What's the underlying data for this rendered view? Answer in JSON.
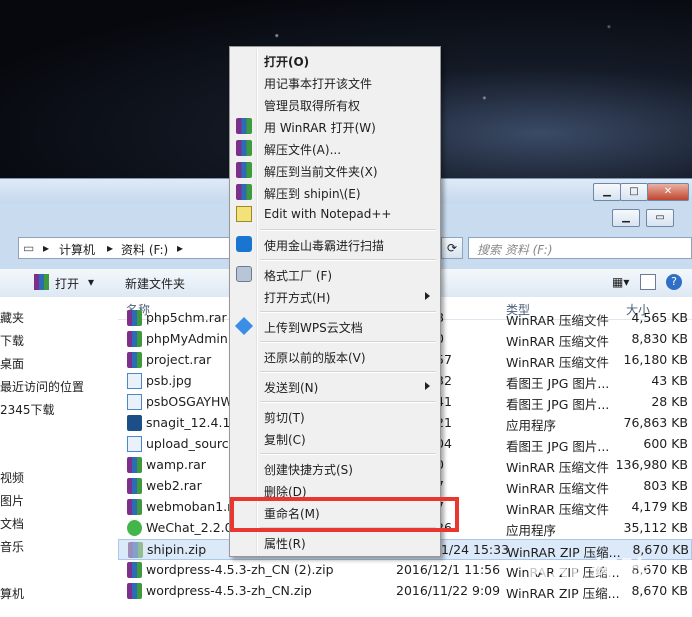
{
  "address": {
    "path": [
      "计算机",
      "资料 (F:)"
    ],
    "search_placeholder": "搜索 资料 (F:)"
  },
  "toolbar": {
    "open_label": "打开",
    "new_folder_label": "新建文件夹"
  },
  "sidebar": [
    {
      "label": "藏夹"
    },
    {
      "label": "下载"
    },
    {
      "label": "桌面"
    },
    {
      "label": "最近访问的位置"
    },
    {
      "label": "2345下载"
    },
    {
      "label": "视频"
    },
    {
      "label": "图片"
    },
    {
      "label": "文档"
    },
    {
      "label": "音乐"
    },
    {
      "label": "算机"
    }
  ],
  "columns": {
    "name": "名称",
    "type": "类型",
    "size": "大小"
  },
  "files": [
    {
      "name": "php5chm.rar",
      "date": "22 9:08",
      "type": "WinRAR 压缩文件",
      "size": "4,565 KB",
      "icon": "rar"
    },
    {
      "name": "phpMyAdmin.",
      "date": "22 9:10",
      "type": "WinRAR 压缩文件",
      "size": "8,830 KB",
      "icon": "rar"
    },
    {
      "name": "project.rar",
      "date": "24 14:57",
      "type": "WinRAR 压缩文件",
      "size": "16,180 KB",
      "icon": "rar"
    },
    {
      "name": "psb.jpg",
      "date": "21 10:32",
      "type": "看图王 JPG 图片...",
      "size": "43 KB",
      "icon": "jpg"
    },
    {
      "name": "psbOSGAYHW",
      "date": "21 10:41",
      "type": "看图王 JPG 图片...",
      "size": "28 KB",
      "icon": "jpg"
    },
    {
      "name": "snagit_12.4.1.3",
      "date": "15 12:21",
      "type": "应用程序",
      "size": "76,863 KB",
      "icon": "app"
    },
    {
      "name": "upload_source",
      "date": "30 16:04",
      "type": "看图王 JPG 图片...",
      "size": "600 KB",
      "icon": "jpg"
    },
    {
      "name": "wamp.rar",
      "date": "22 9:10",
      "type": "WinRAR 压缩文件",
      "size": "136,980 KB",
      "icon": "rar"
    },
    {
      "name": "web2.rar",
      "date": "22 9:07",
      "type": "WinRAR 压缩文件",
      "size": "803 KB",
      "icon": "rar"
    },
    {
      "name": "webmoban1.ra",
      "date": "22 9:07",
      "type": "WinRAR 压缩文件",
      "size": "4,179 KB",
      "icon": "rar"
    },
    {
      "name": "WeChat_2.2.0.",
      "date": "22 11:26",
      "type": "应用程序",
      "size": "35,112 KB",
      "icon": "wechat"
    },
    {
      "name": "shipin.zip",
      "date": "2016/11/24 15:33",
      "type": "WinRAR ZIP 压缩...",
      "size": "8,670 KB",
      "icon": "zipsel",
      "selected": true
    },
    {
      "name": "wordpress-4.5.3-zh_CN (2).zip",
      "date": "2016/12/1 11:56",
      "type": "WinRAR ZIP 压缩...",
      "size": "8,670 KB",
      "icon": "rar"
    },
    {
      "name": "wordpress-4.5.3-zh_CN.zip",
      "date": "2016/11/22 9:09",
      "type": "WinRAR ZIP 压缩...",
      "size": "8,670 KB",
      "icon": "rar"
    }
  ],
  "context_menu": [
    {
      "label": "打开(O)",
      "bold": true,
      "icon": ""
    },
    {
      "label": "用记事本打开该文件",
      "icon": ""
    },
    {
      "label": "管理员取得所有权",
      "icon": ""
    },
    {
      "label": "用 WinRAR 打开(W)",
      "icon": "rar"
    },
    {
      "label": "解压文件(A)...",
      "icon": "rar"
    },
    {
      "label": "解压到当前文件夹(X)",
      "icon": "rar"
    },
    {
      "label": "解压到 shipin\\(E)",
      "icon": "rar"
    },
    {
      "label": "Edit with Notepad++",
      "icon": "note"
    },
    {
      "sep": true
    },
    {
      "label": "使用金山毒霸进行扫描",
      "icon": "jinshan"
    },
    {
      "sep": true
    },
    {
      "label": "格式工厂 (F)",
      "icon": "format"
    },
    {
      "label": "打开方式(H)",
      "icon": "",
      "submenu": true
    },
    {
      "sep": true
    },
    {
      "label": "上传到WPS云文档",
      "icon": "wps"
    },
    {
      "sep": true
    },
    {
      "label": "还原以前的版本(V)",
      "icon": ""
    },
    {
      "sep": true
    },
    {
      "label": "发送到(N)",
      "icon": "",
      "submenu": true
    },
    {
      "sep": true
    },
    {
      "label": "剪切(T)",
      "icon": ""
    },
    {
      "label": "复制(C)",
      "icon": ""
    },
    {
      "sep": true
    },
    {
      "label": "创建快捷方式(S)",
      "icon": ""
    },
    {
      "label": "删除(D)",
      "icon": ""
    },
    {
      "label": "重命名(M)",
      "icon": "",
      "highlighted": true
    },
    {
      "sep": true
    },
    {
      "label": "属性(R)",
      "icon": ""
    }
  ],
  "watermark": "Bai 经验"
}
